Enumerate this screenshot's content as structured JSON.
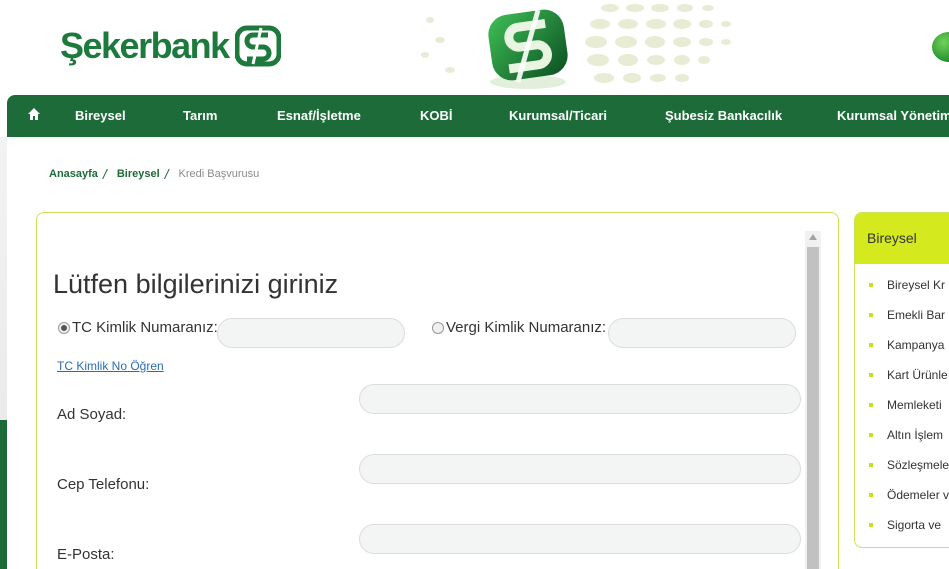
{
  "brand": {
    "name": "Şekerbank",
    "accent": "#1d6b38",
    "lime": "#d4ea1f"
  },
  "nav": {
    "home_icon": "home-icon",
    "items": [
      "Bireysel",
      "Tarım",
      "Esnaf/İşletme",
      "KOBİ",
      "Kurumsal/Ticari",
      "Şubesiz Bankacılık",
      "Kurumsal Yönetim"
    ]
  },
  "breadcrumb": {
    "home": "Anasayfa",
    "section": "Bireysel",
    "current": "Kredi Başvurusu"
  },
  "form": {
    "title": "Lütfen bilgilerinizi giriniz",
    "tc_label": "TC Kimlik Numaranız:",
    "vergi_label": "Vergi Kimlik Numaranız:",
    "tc_selected": true,
    "learn_link": "TC Kimlik No Öğren",
    "fields": [
      {
        "label": "Ad Soyad:",
        "value": ""
      },
      {
        "label": "Cep Telefonu:",
        "value": ""
      },
      {
        "label": "E-Posta:",
        "value": ""
      }
    ]
  },
  "sidebar": {
    "title": "Bireysel",
    "items": [
      "Bireysel Kr",
      "Emekli Bar",
      "Kampanya",
      "Kart Ürünle",
      "Memleketi",
      "Altın İşlem",
      "Sözleşmele",
      "Ödemeler v",
      "Sigorta ve"
    ]
  }
}
